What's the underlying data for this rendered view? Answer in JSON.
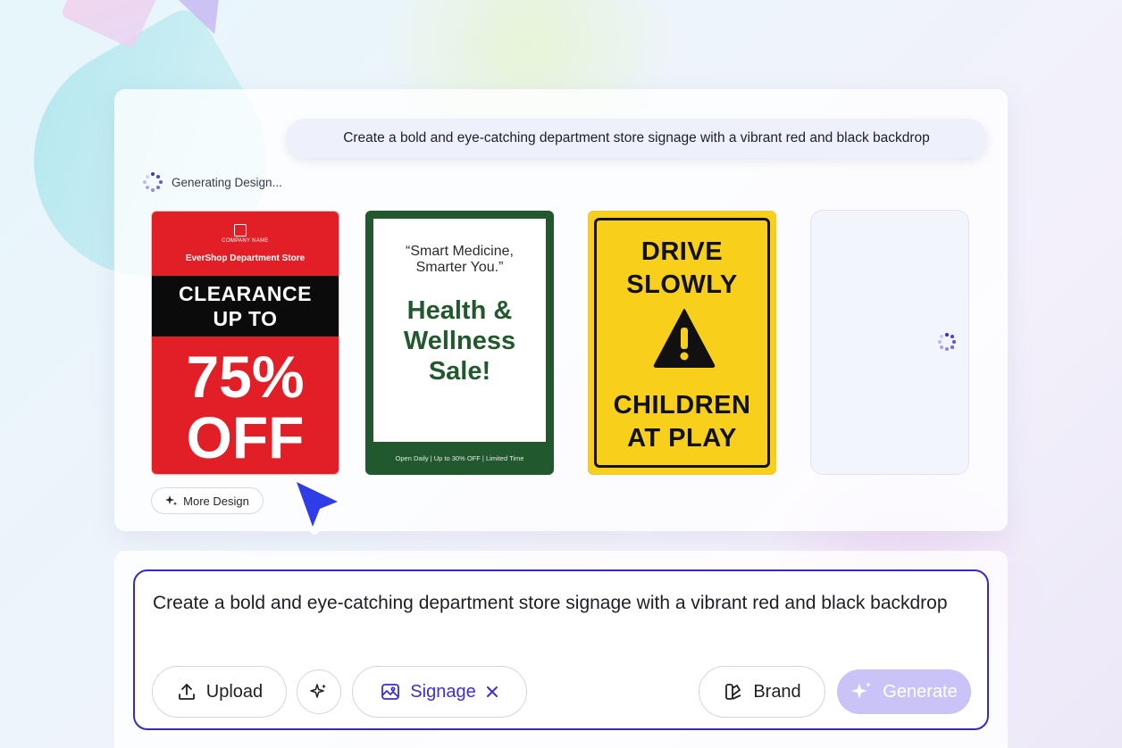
{
  "prompt": {
    "text": "Create a bold and eye-catching department store signage with a vibrant red and black backdrop"
  },
  "status": {
    "text": "Generating Design..."
  },
  "designs": {
    "red_card": {
      "company": "COMPANY NAME",
      "store": "EverShop Department Store",
      "clearance_line1": "CLEARANCE",
      "clearance_line2": "UP TO",
      "percent": "75%",
      "off": "OFF",
      "color": "#e21f26"
    },
    "green_card": {
      "quote_line1": "“Smart Medicine,",
      "quote_line2": "Smarter You.”",
      "headline_line1": "Health &",
      "headline_line2": "Wellness",
      "headline_line3": "Sale!",
      "footer": "Open Daily | Up to 30% OFF | Limited Time",
      "color": "#22582e"
    },
    "yellow_card": {
      "line1": "DRIVE",
      "line2": "SLOWLY",
      "line3": "CHILDREN",
      "line4": "AT PLAY",
      "icon": "warning-icon",
      "color": "#f8cf1b"
    }
  },
  "more_design": {
    "label": "More Design",
    "icon": "sparkle-icon"
  },
  "input": {
    "value": "Create a bold and eye-catching department store signage with a vibrant red and black backdrop"
  },
  "toolbar": {
    "upload_label": "Upload",
    "magic_icon": "sparkle-icon",
    "signage_label": "Signage",
    "brand_label": "Brand",
    "generate_label": "Generate"
  },
  "colors": {
    "accent": "#3b2fd1",
    "input_border": "#3829c4",
    "generate_disabled": "#cac3f7"
  }
}
